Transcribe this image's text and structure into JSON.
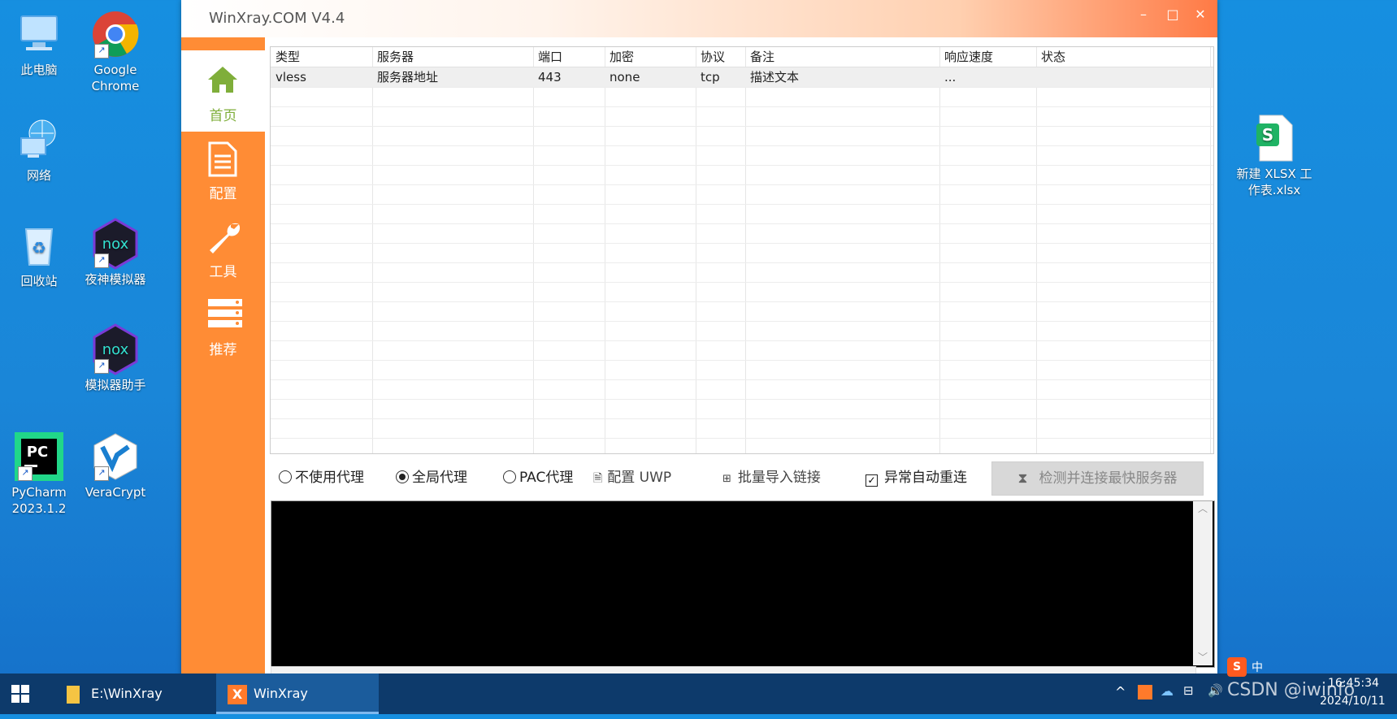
{
  "desktop": {
    "icons_left": [
      {
        "label_1": "此电脑",
        "label_2": ""
      },
      {
        "label_1": "Google",
        "label_2": "Chrome"
      },
      {
        "label_1": "网络",
        "label_2": ""
      },
      {
        "label_1": "回收站",
        "label_2": ""
      },
      {
        "label_1": "夜神模拟器",
        "label_2": ""
      },
      {
        "label_1": "模拟器助手",
        "label_2": ""
      },
      {
        "label_1": "PyCharm",
        "label_2": "2023.1.2"
      },
      {
        "label_1": "VeraCrypt",
        "label_2": ""
      }
    ],
    "icon_right": {
      "label_1": "新建 XLSX 工",
      "label_2": "作表.xlsx"
    }
  },
  "window": {
    "title": "WinXray.COM    V4.4",
    "colors": {
      "accent": "#ff8c35",
      "active_nav_text": "#7fae3a"
    }
  },
  "sidebar": {
    "items": [
      {
        "label": "首页",
        "icon": "home-icon",
        "active": true
      },
      {
        "label": "配置",
        "icon": "document-icon",
        "active": false
      },
      {
        "label": "工具",
        "icon": "wrench-icon",
        "active": false
      },
      {
        "label": "推荐",
        "icon": "server-rack-icon",
        "active": false
      }
    ]
  },
  "table": {
    "columns": [
      "类型",
      "服务器",
      "端口",
      "加密",
      "协议",
      "备注",
      "响应速度",
      "状态"
    ],
    "rows": [
      [
        "vless",
        "服务器地址",
        "443",
        "none",
        "tcp",
        "描述文本",
        "...",
        ""
      ]
    ]
  },
  "options": {
    "no_proxy": "不使用代理",
    "global_proxy": "全局代理",
    "pac_proxy": "PAC代理",
    "config_uwp": "配置 UWP",
    "batch_import": "批量导入链接",
    "auto_reconnect": "异常自动重连",
    "selected_mode": "global",
    "auto_reconnect_checked": true,
    "test_button": "检测并连接最快服务器"
  },
  "taskbar": {
    "items": [
      {
        "label": "E:\\WinXray"
      },
      {
        "label": "WinXray"
      }
    ],
    "ime": "中",
    "time": "16:45:34",
    "date": "2024/10/11",
    "watermark": "CSDN @iwinfo"
  }
}
